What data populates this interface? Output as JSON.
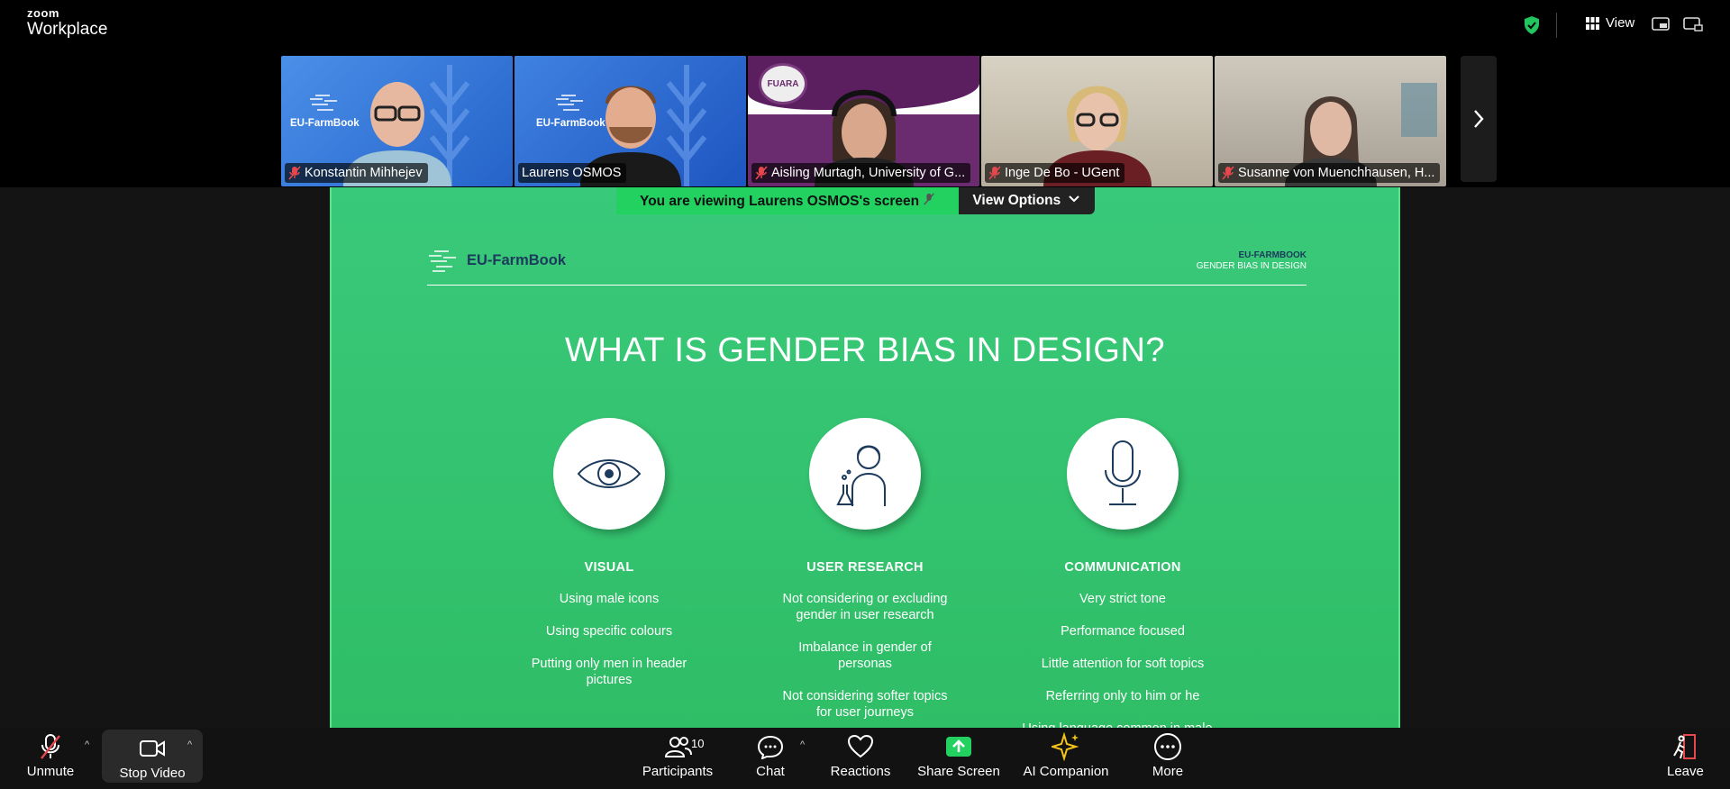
{
  "topbar": {
    "brand_top": "zoom",
    "brand_bottom": "Workplace",
    "view_label": "View"
  },
  "participants_strip": [
    {
      "name": "Konstantin Mihhejev",
      "muted": true,
      "bg": "#3a78d6",
      "has_logo": true
    },
    {
      "name": "Laurens OSMOS",
      "muted": false,
      "bg": "#2f6ed4",
      "has_logo": true,
      "active": true
    },
    {
      "name": "Aisling Murtagh, University of G...",
      "muted": true,
      "bg": "#5a1f5e",
      "has_logo": false
    },
    {
      "name": "Inge De Bo - UGent",
      "muted": true,
      "bg": "#c9c2b2",
      "has_logo": false
    },
    {
      "name": "Susanne von Muenchhausen, H...",
      "muted": true,
      "bg": "#bdb6ac",
      "has_logo": false
    }
  ],
  "tile_logo_text": "EU-FarmBook",
  "banner": {
    "viewing_text": "You are viewing  Laurens OSMOS's screen",
    "view_options": "View Options"
  },
  "slide": {
    "logo_text": "EU-FarmBook",
    "tag_line1": "EU-FARMBOOK",
    "tag_line2": "GENDER BIAS IN DESIGN",
    "title": "WHAT IS GENDER BIAS IN DESIGN?",
    "columns": [
      {
        "heading": "VISUAL",
        "icon": "eye-icon",
        "items": [
          "Using male icons",
          "Using specific colours",
          "Putting only men in header pictures"
        ]
      },
      {
        "heading": "USER RESEARCH",
        "icon": "scientist-icon",
        "items": [
          "Not considering or excluding gender in user research",
          "Imbalance in gender of personas",
          "Not considering softer topics for user journeys"
        ]
      },
      {
        "heading": "COMMUNICATION",
        "icon": "microphone-icon",
        "items": [
          "Very strict tone",
          "Performance focused",
          "Little attention for soft topics",
          "Referring only to him or he",
          "Using language common in male..."
        ]
      }
    ]
  },
  "controls": {
    "unmute": "Unmute",
    "stop_video": "Stop Video",
    "participants": "Participants",
    "participants_count": "10",
    "chat": "Chat",
    "reactions": "Reactions",
    "share_screen": "Share Screen",
    "ai_companion": "AI Companion",
    "more": "More",
    "leave": "Leave"
  },
  "colors": {
    "slide_green": "#36c472",
    "banner_green": "#22d160",
    "share_green": "#22d160",
    "leave_red": "#e5484d",
    "ai_yellow": "#f5c518"
  }
}
